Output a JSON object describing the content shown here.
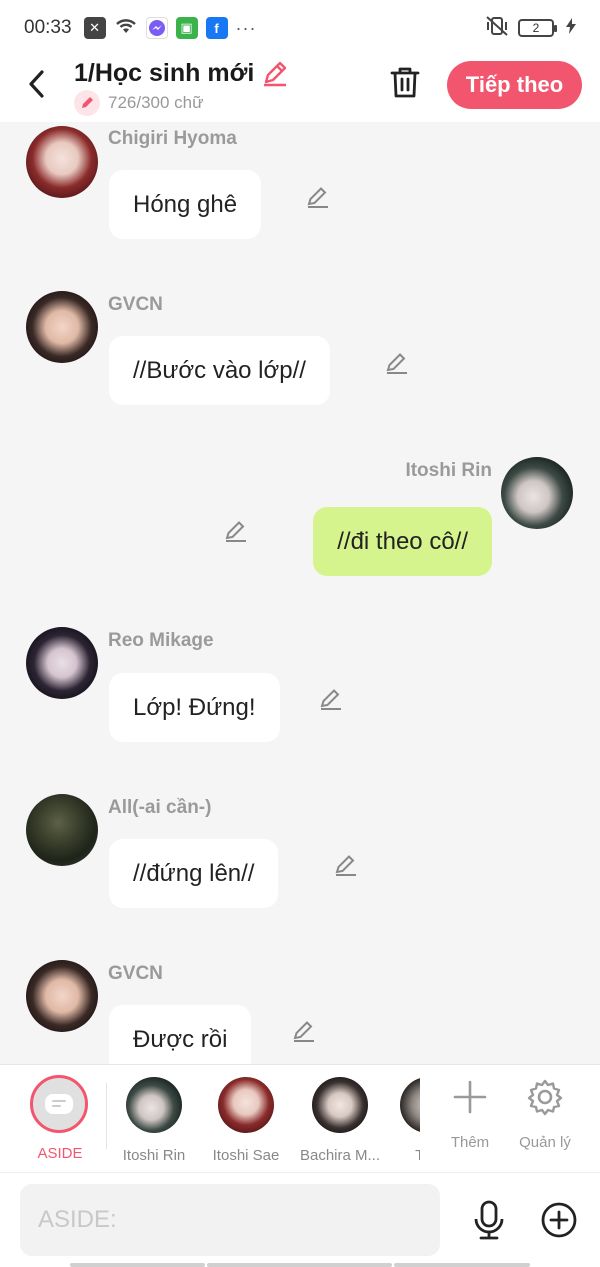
{
  "status_bar": {
    "time": "00:33",
    "dots": "···",
    "battery": "2"
  },
  "header": {
    "title": "1/Học sinh mới",
    "count": "726/300 chữ",
    "next_label": "Tiếp theo",
    "accent": "#f2566e"
  },
  "messages": [
    {
      "sender": "Chigiri Hyoma",
      "text": "Hóng ghê",
      "side": "left"
    },
    {
      "sender": "GVCN",
      "text": "//Bước vào lớp//",
      "side": "left"
    },
    {
      "sender": "Itoshi Rin",
      "text": "//đi theo cô//",
      "side": "right"
    },
    {
      "sender": "Reo Mikage",
      "text": "Lớp! Đứng!",
      "side": "left"
    },
    {
      "sender": "All(-ai cần-)",
      "text": "//đứng lên//",
      "side": "left"
    },
    {
      "sender": "GVCN",
      "text": "Được rồi",
      "side": "left"
    }
  ],
  "characters": {
    "aside_label": "ASIDE",
    "items": [
      {
        "name": "Itoshi Rin"
      },
      {
        "name": "Itoshi Sae"
      },
      {
        "name": "Bachira M..."
      },
      {
        "name": "Thủ"
      }
    ],
    "more_label": "Thêm",
    "manage_label": "Quản lý"
  },
  "composer": {
    "placeholder": "ASIDE:"
  }
}
